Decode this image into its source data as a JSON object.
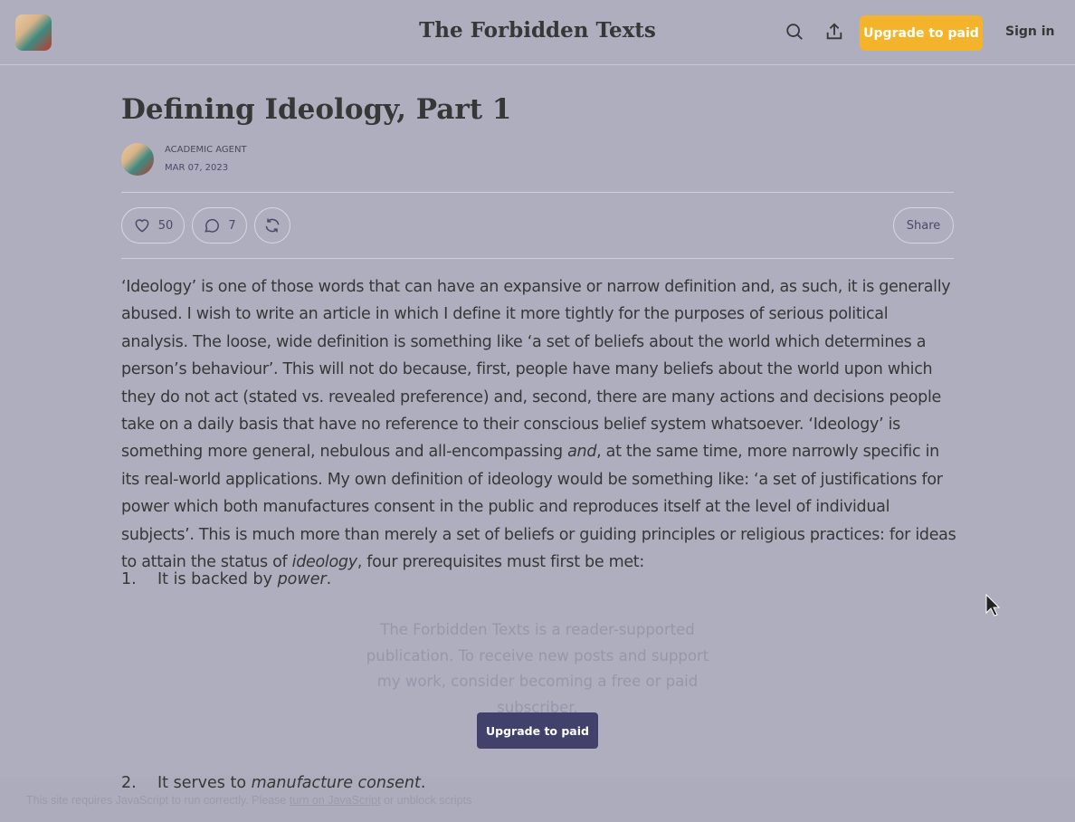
{
  "header": {
    "title": "The Forbidden Texts",
    "upgrade_label": "Upgrade to paid",
    "signin_label": "Sign in",
    "icons": [
      "search-icon",
      "share-icon"
    ]
  },
  "post": {
    "title": "Defining Ideology, Part 1",
    "author": "ACADEMIC AGENT",
    "date": "MAR 07, 2023",
    "likes": "50",
    "comments": "7",
    "share_label": "Share"
  },
  "body": {
    "p1a": "‘Ideology’ is one of those words that can have an expansive or narrow definition and, as such, it is generally abused. I wish to write an article in which I define it more tightly for the purposes of serious political analysis. The loose, wide definition is something like ‘a set of beliefs about the world which determines a person’s behaviour’. This will not do because, first, people have many beliefs about the world upon which they do not act (stated vs. revealed preference) and, second, there are many actions and decisions people take on a daily basis that have no reference to their conscious belief system whatsoever. ‘Ideology’ is something more general, nebulous and all-encompassing ",
    "p1b": "and",
    "p1c": ", at the same time, more narrowly specific in its real-world applications. My own definition of ideology would be something like: ‘a set of justifications for power which both manufactures consent in the public and reproduces itself at the level of individual subjects’. This is much more than merely a set of beliefs or guiding principles or religious practices: for ideas to attain the status of ",
    "p1d": "ideology",
    "p1e": ", four prerequisites must first be met:",
    "list": [
      {
        "num": "1.",
        "text": "It is backed by ",
        "em": "power",
        "end": "."
      },
      {
        "num": "2.",
        "text": "It serves to ",
        "em": "manufacture consent",
        "end": "."
      }
    ]
  },
  "subscribe": {
    "text": "The Forbidden Texts is a reader-supported publication. To receive new posts and support my work, consider becoming a free or paid subscriber.",
    "button": "Upgrade to paid"
  },
  "footer": {
    "pre": "This site requires JavaScript to run correctly. Please ",
    "link": "turn on JavaScript",
    "post": " or unblock scripts"
  },
  "colors": {
    "accent": "#f3b42b",
    "button_dark": "#42416c",
    "background": "#aeaebf"
  }
}
